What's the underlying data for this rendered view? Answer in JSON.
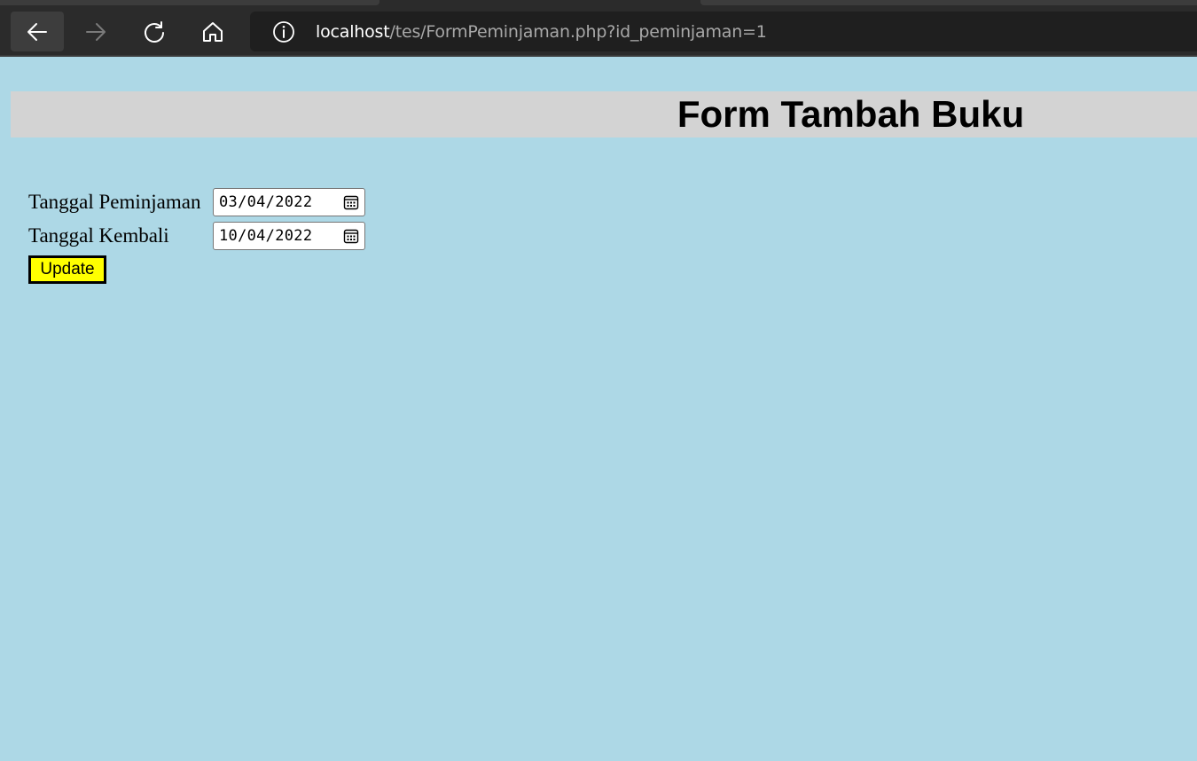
{
  "browser": {
    "url_host": "localhost",
    "url_path": "/tes/FormPeminjaman.php?id_peminjaman=1",
    "icons": {
      "back": "back-arrow-icon",
      "forward": "forward-arrow-icon",
      "refresh": "refresh-icon",
      "home": "home-icon",
      "info": "info-icon"
    }
  },
  "page": {
    "title": "Form Tambah Buku",
    "background_color": "#add8e6",
    "header_color": "#d3d3d3"
  },
  "form": {
    "fields": [
      {
        "label": "Tanggal Peminjaman",
        "value": "03/04/2022"
      },
      {
        "label": "Tanggal Kembali",
        "value": "10/04/2022"
      }
    ],
    "submit_label": "Update",
    "submit_color": "#ffff00"
  }
}
